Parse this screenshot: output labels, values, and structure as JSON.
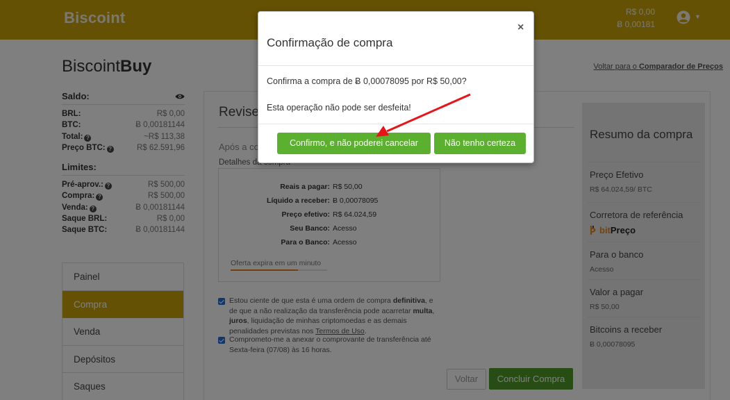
{
  "header": {
    "brand": "Biscoint",
    "balance_brl": "R$ 0,00",
    "balance_btc": "Ƀ 0,00181"
  },
  "page": {
    "title_light": "Biscoint",
    "title_bold": "Buy",
    "back_link_prefix": "Voltar para o ",
    "back_link_bold": "Comparador de Preços"
  },
  "saldo": {
    "heading": "Saldo:",
    "rows": [
      {
        "label": "BRL:",
        "value": "R$ 0,00",
        "help": false
      },
      {
        "label": "BTC:",
        "value": "Ƀ 0,00181144",
        "help": false
      },
      {
        "label": "Total:",
        "value": "~R$ 113,38",
        "help": true
      },
      {
        "label": "Preço BTC:",
        "value": "R$ 62.591,96",
        "help": true
      }
    ]
  },
  "limites": {
    "heading": "Limites:",
    "rows": [
      {
        "label": "Pré-aprov.:",
        "value": "R$ 500,00",
        "help": true
      },
      {
        "label": "Compra:",
        "value": "R$ 500,00",
        "help": true
      },
      {
        "label": "Venda:",
        "value": "Ƀ 0,00181144",
        "help": true
      },
      {
        "label": "Saque BRL:",
        "value": "R$ 0,00",
        "help": false
      },
      {
        "label": "Saque BTC:",
        "value": "Ƀ 0,00181144",
        "help": false
      }
    ]
  },
  "menu": {
    "items": [
      {
        "label": "Painel",
        "active": false
      },
      {
        "label": "Compra",
        "active": true
      },
      {
        "label": "Venda",
        "active": false
      },
      {
        "label": "Depósitos",
        "active": false
      },
      {
        "label": "Saques",
        "active": false
      }
    ]
  },
  "review": {
    "title": "Revise",
    "subtitle": "Após a co",
    "details_label": "Detalhes da compra",
    "details": [
      {
        "label": "Reais a pagar:",
        "value": "R$ 50,00"
      },
      {
        "label": "Líquido a receber:",
        "value": "Ƀ 0,00078095"
      },
      {
        "label": "Preço efetivo:",
        "value": "R$ 64.024,59"
      },
      {
        "label": "Seu Banco:",
        "value": "Acesso"
      },
      {
        "label": "Para o Banco:",
        "value": "Acesso"
      }
    ],
    "expira_label": "Oferta expira em um minuto",
    "expira_progress": 0.7,
    "check1_a": "Estou ciente de que esta é uma ordem de compra ",
    "check1_b": "definitiva",
    "check1_c": ", e de que a não realização da transferência pode acarretar ",
    "check1_d": "multa",
    "check1_e": ", ",
    "check1_f": "juros",
    "check1_g": ", liquidação de minhas criptomoedas e as demais penalidades previstas nos ",
    "check1_h": "Termos de Uso",
    "check1_i": ".",
    "check2": "Comprometo-me a anexar o comprovante de transferência até Sexta-feira (07/08) às 16 horas.",
    "btn_back": "Voltar",
    "btn_finish": "Concluir Compra"
  },
  "summary": {
    "title": "Resumo da compra",
    "items": [
      {
        "label": "Preço Efetivo",
        "value": "R$ 64.024,59/ BTC"
      },
      {
        "label": "Corretora de referência",
        "value": ""
      },
      {
        "label": "Para o banco",
        "value": "Acesso"
      },
      {
        "label": "Valor a pagar",
        "value": "R$ 50,00"
      },
      {
        "label": "Bitcoins a receber",
        "value": "Ƀ 0,00078095"
      }
    ],
    "broker_logo_a": "bit",
    "broker_logo_b": "Preço"
  },
  "modal": {
    "title": "Confirmação de compra",
    "close": "×",
    "question": "Confirma a compra de Ƀ 0,00078095 por R$ 50,00?",
    "warning": "Esta operação não pode ser desfeita!",
    "btn_confirm": "Confirmo, e não poderei cancelar",
    "btn_unsure": "Não tenho certeza"
  },
  "colors": {
    "brand": "#c9a308",
    "confirm_green": "#5cb030",
    "annotation_arrow": "#e8141a"
  },
  "icons": {
    "eye": "eye-icon",
    "help": "question-circle-icon",
    "user": "user-circle-icon"
  }
}
